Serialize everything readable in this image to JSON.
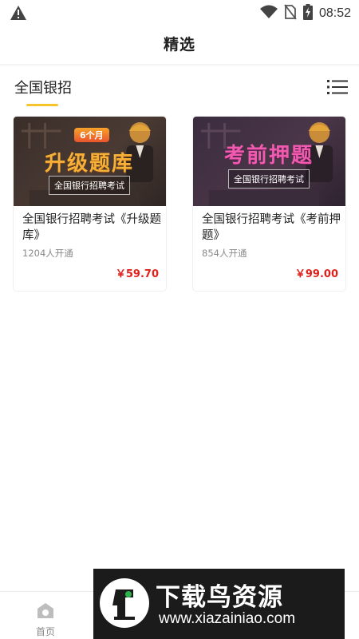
{
  "status_bar": {
    "time": "08:52",
    "icons": [
      "warning-icon",
      "wifi-icon",
      "no-sim-icon",
      "battery-charging-icon"
    ]
  },
  "header": {
    "title": "精选"
  },
  "category": {
    "tab_label": "全国银招",
    "accent_color": "#f5c62c",
    "menu_icon": "list-menu-icon"
  },
  "courses": [
    {
      "banner_tag": "6个月",
      "banner_title": "升级题库",
      "banner_subtitle": "全国银行招聘考试",
      "title": "全国银行招聘考试《升级题库》",
      "enrolled": "1204人开通",
      "price": "￥59.70"
    },
    {
      "banner_title": "考前押题",
      "banner_subtitle": "全国银行招聘考试",
      "title": "全国银行招聘考试《考前押题》",
      "enrolled": "854人开通",
      "price": "￥99.00"
    }
  ],
  "colors": {
    "price": "#e0221c",
    "accent": "#f5c62c"
  },
  "bottom_nav": {
    "home_label": "首页",
    "home_icon": "home-icon"
  },
  "watermark": {
    "name": "下载鸟资源",
    "url": "www.xiazainiao.com"
  }
}
